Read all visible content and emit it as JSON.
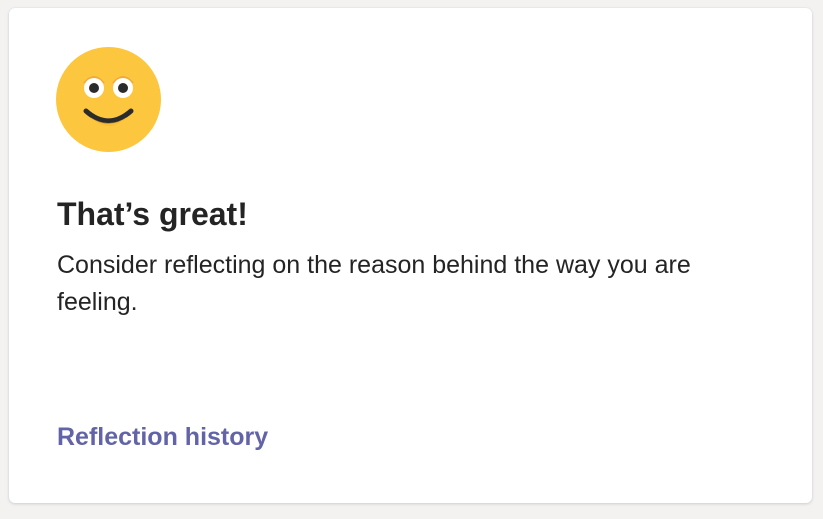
{
  "card": {
    "icon": "smiling-face-icon",
    "title": "That’s great!",
    "message": "Consider reflecting on the reason behind the way you are feeling.",
    "link_label": "Reflection history"
  },
  "colors": {
    "emoji_face": "#fcc63e",
    "link": "#6264a7",
    "text": "#242424"
  }
}
